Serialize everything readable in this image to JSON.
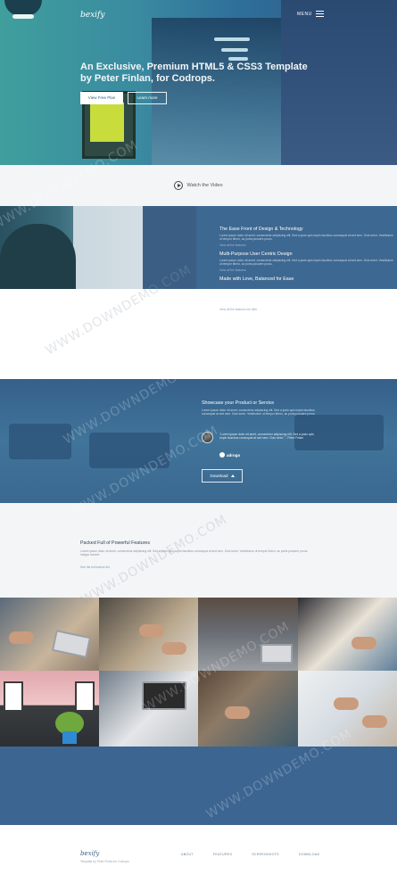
{
  "hero": {
    "logo": "bexify",
    "menu_label": "MENU",
    "title": "An Exclusive, Premium HTML5 & CSS3 Template by Peter Finlan, for Codrops.",
    "primary_button": "View Free Plan",
    "secondary_button": "Learn more"
  },
  "video": {
    "label": "Watch the Video"
  },
  "features": {
    "items": [
      {
        "title": "The Ease Front of Design & Technology",
        "text": "Lorem ipsum dolor sit amet, consectetur adipiscing elit. Sed a justo quis turpis faucibus consequat at sed sem. Duis tortor. Vestibulum ut tempor libero, ac porta posuere purus."
      },
      {
        "title": "Multi-Purpose User Centric Design",
        "text": "Lorem ipsum dolor sit amet, consectetur adipiscing elit. Sed a justo quis turpis faucibus consequat at sed sem. Duis tortor. Vestibulum ut tempor libero, ac porta posuere purus."
      },
      {
        "title": "Made with Love, Balanced for Ease",
        "text": ""
      }
    ],
    "item_link": "View all the features",
    "link": "View all the features we offer"
  },
  "showcase": {
    "title": "Showcase your Product or Service",
    "text": "Lorem ipsum dolor sit amet, consectetur adipiscing elit. Sed a justo quis turpis faucibus consequat at sed sem. Duis tortor. Vestibulum ut tempor libero, ac porta posuere purus.",
    "quote": "\"Lorem ipsum dolor sit amet, consectetur adipiscing elit. Sed a justo quis turpis faucibus consequat at sed sem. Duis tortor.\" - Peter Finlan",
    "partner": "adrogo",
    "download_button": "Download"
  },
  "packed": {
    "title": "Packed Full of Powerful Features",
    "text": "Lorem ipsum dolor sit amet, consectetur adipiscing elit. Sed a justo quis turpis faucibus consequat at sed sem. Duis tortor. Vestibulum ut tempor libero, ac porta posuere purus. Integer laoreet.",
    "link": "See the full feature list"
  },
  "footer": {
    "logo": "bexify",
    "copyright": "Template by Peter Finlan for Codrops",
    "nav": [
      "ABOUT",
      "FEATURES",
      "SCREENSHOTS",
      "DOWNLOAD"
    ]
  },
  "watermark": "WWW.DOWNDEMO.COM"
}
